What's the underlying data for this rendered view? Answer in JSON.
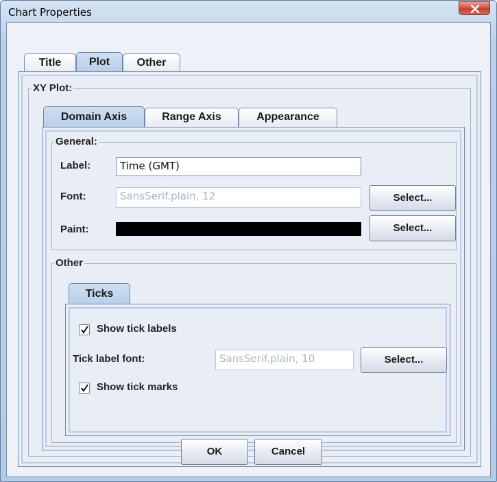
{
  "window": {
    "title": "Chart Properties"
  },
  "top_tabs": [
    "Title",
    "Plot",
    "Other"
  ],
  "xy_plot": {
    "legend": "XY Plot:"
  },
  "axis_tabs": [
    "Domain Axis",
    "Range Axis",
    "Appearance"
  ],
  "general": {
    "legend": "General:",
    "label_label": "Label:",
    "label_value": "Time (GMT)",
    "font_label": "Font:",
    "font_value": "SansSerif.plain, 12",
    "font_button": "Select...",
    "paint_label": "Paint:",
    "paint_color": "#000000",
    "paint_button": "Select..."
  },
  "other": {
    "legend": "Other",
    "ticks_tab": "Ticks",
    "show_tick_labels": "Show tick labels",
    "show_tick_labels_checked": true,
    "tick_label_font_label": "Tick label font:",
    "tick_label_font_value": "SansSerif.plain, 10",
    "tick_font_button": "Select...",
    "show_tick_marks": "Show tick marks",
    "show_tick_marks_checked": true
  },
  "buttons": {
    "ok": "OK",
    "cancel": "Cancel"
  }
}
